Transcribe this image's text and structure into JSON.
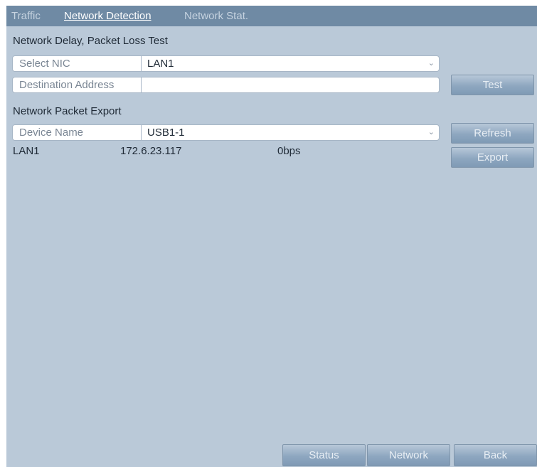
{
  "tabs": [
    {
      "label": "Traffic",
      "active": false
    },
    {
      "label": "Network Detection",
      "active": true
    },
    {
      "label": "Network Stat.",
      "active": false
    }
  ],
  "delay_test": {
    "title": "Network Delay, Packet Loss Test",
    "nic_label": "Select NIC",
    "nic_value": "LAN1",
    "dest_label": "Destination Address",
    "dest_value": "",
    "test_button": "Test"
  },
  "packet_export": {
    "title": "Network Packet Export",
    "device_label": "Device Name",
    "device_value": "USB1-1",
    "refresh_button": "Refresh",
    "export_button": "Export",
    "interface": "LAN1",
    "ip": "172.6.23.117",
    "rate": "0bps"
  },
  "footer": {
    "status_button": "Status",
    "network_button": "Network",
    "back_button": "Back"
  },
  "icons": {
    "dropdown": "chevron-down-icon"
  },
  "colors": {
    "panel_bg": "#bac9d8",
    "tabbar_bg": "#6f8aa4",
    "active_tab": "#ffffff",
    "button": "#8ea7c0"
  }
}
